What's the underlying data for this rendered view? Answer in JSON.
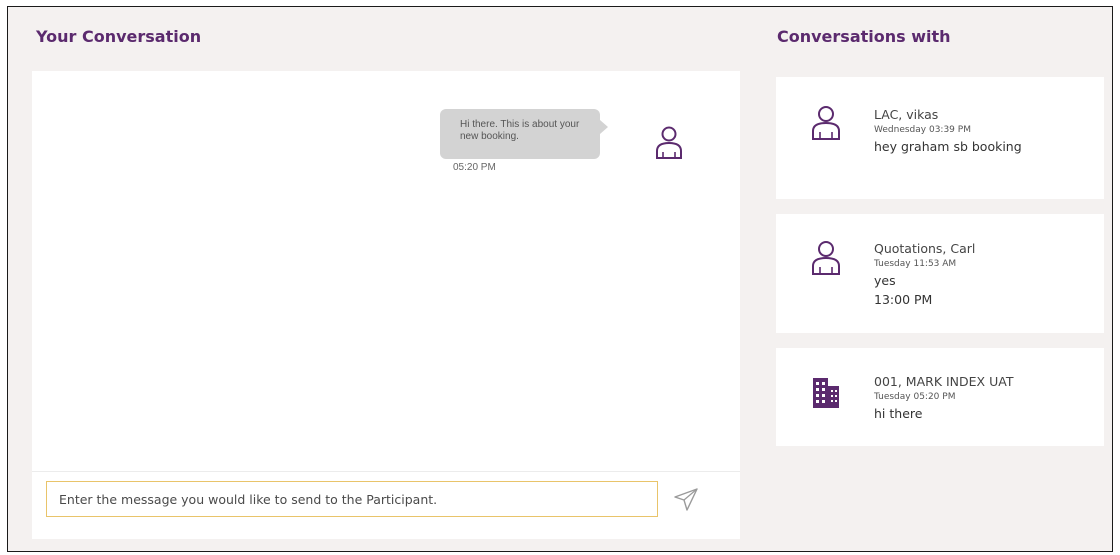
{
  "conversation": {
    "title": "Your Conversation",
    "messages": [
      {
        "text": "Hi there. This is about your new booking.",
        "time": "05:20 PM",
        "avatar_icon": "user-icon"
      }
    ],
    "input": {
      "placeholder": "Enter the message you would like to send to the Participant.",
      "value": ""
    },
    "send_icon": "send-icon"
  },
  "sidebar": {
    "title": "Conversations with",
    "items": [
      {
        "name": "LAC, vikas",
        "time": "Wednesday 03:39 PM",
        "message": "hey graham sb booking",
        "icon": "user-icon"
      },
      {
        "name": "Quotations, Carl",
        "time": "Tuesday 11:53 AM",
        "message": "yes",
        "message_extra": "13:00 PM",
        "icon": "user-icon"
      },
      {
        "name": "001, MARK INDEX UAT",
        "time": "Tuesday 05:20 PM",
        "message": "hi there",
        "icon": "building-icon"
      }
    ]
  },
  "colors": {
    "accent": "#5b2a6e",
    "background": "#f4f1f0",
    "bubble": "#d3d3d3",
    "input_border": "#e9c46a"
  }
}
